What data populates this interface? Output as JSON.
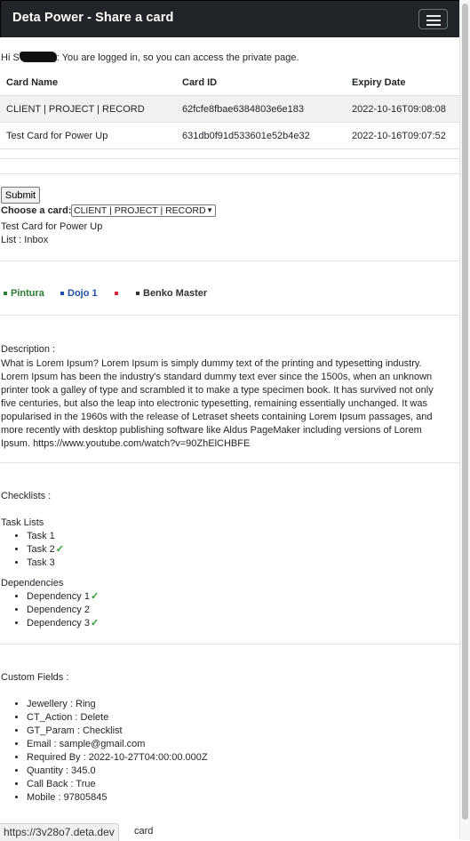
{
  "navbar": {
    "title": "Deta Power - Share a card"
  },
  "greeting": {
    "prefix": "Hi S",
    "suffix": ": You are logged in, so you can access the private page."
  },
  "table": {
    "headers": [
      "Card Name",
      "Card ID",
      "Expiry Date"
    ],
    "rows": [
      [
        "CLIENT | PROJECT | RECORD",
        "62fcfe8fbae6384803e6e183",
        "2022-10-16T09:08:08"
      ],
      [
        "Test Card for Power Up",
        "631db0f91d533601e52b4e32",
        "2022-10-16T09:07:52"
      ]
    ]
  },
  "form": {
    "submit_label": "Submit",
    "choose_label": "Choose a card:",
    "selected_card": "CLIENT | PROJECT | RECORD"
  },
  "card": {
    "name": "Test Card for Power Up",
    "list": "List : Inbox",
    "labels": [
      {
        "name": "Pintura",
        "color": "#2e7d32"
      },
      {
        "name": "Dojo 1",
        "color": "#1f4fa8"
      },
      {
        "name": "",
        "color": "#d62839"
      },
      {
        "name": "Benko Master",
        "color": "#333333"
      }
    ],
    "description_heading": "Description :",
    "description": "What is Lorem Ipsum? Lorem Ipsum is simply dummy text of the printing and typesetting industry. Lorem Ipsum has been the industry's standard dummy text ever since the 1500s, when an unknown printer took a galley of type and scrambled it to make a type specimen book. It has survived not only five centuries, but also the leap into electronic typesetting, remaining essentially unchanged. It was popularised in the 1960s with the release of Letraset sheets containing Lorem Ipsum passages, and more recently with desktop publishing software like Aldus PageMaker including versions of Lorem Ipsum. https://www.youtube.com/watch?v=90ZhElCHBFE",
    "checklists_heading": "Checklists :",
    "task_lists_heading": "Task Lists",
    "tasks": [
      {
        "text": "Task 1",
        "done": false
      },
      {
        "text": "Task 2",
        "done": true
      },
      {
        "text": "Task 3",
        "done": false
      }
    ],
    "dependencies_heading": "Dependencies",
    "dependencies": [
      {
        "text": "Dependency 1",
        "done": true
      },
      {
        "text": "Dependency 2",
        "done": false
      },
      {
        "text": "Dependency 3",
        "done": true
      }
    ],
    "check_glyph": "✓",
    "custom_fields_heading": "Custom Fields :",
    "custom_fields": [
      "Jewellery : Ring",
      "CT_Action : Delete",
      "GT_Param : Checklist",
      "Email : sample@gmail.com",
      "Required By : 2022-10-27T04:00:00.000Z",
      "Quantity : 345.0",
      "Call Back : True",
      "Mobile : 97805845"
    ],
    "trailing_text": "card"
  },
  "status_url": "https://3v28o7.deta.dev"
}
